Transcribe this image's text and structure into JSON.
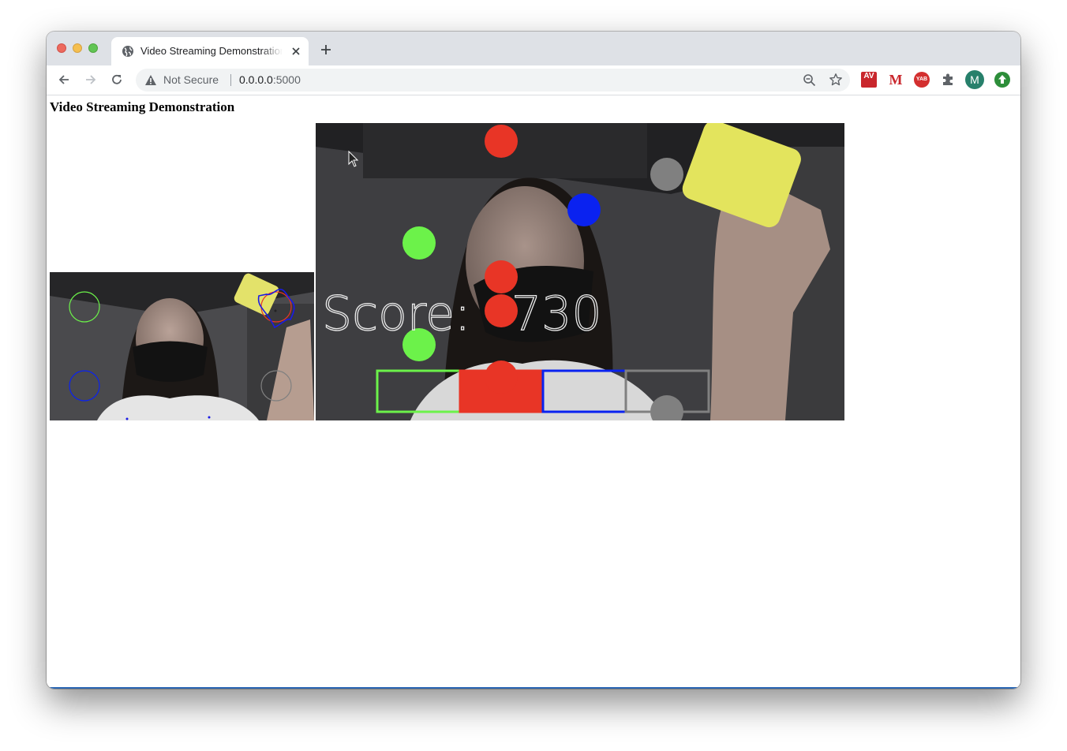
{
  "browser": {
    "tab_title": "Video Streaming Demonstration",
    "security_label": "Not Secure",
    "url_host": "0.0.0.0",
    "url_port": ":5000",
    "profile_initial": "M",
    "ext_av_label": "AV",
    "ext_m_label": "M",
    "ext_yab_label": "YAB"
  },
  "page": {
    "title": "Video Streaming Demonstration"
  },
  "game": {
    "score_label": "Score:",
    "score_value": "730",
    "target_colors": [
      "#6cf24a",
      "#e83526",
      "#0a22f0",
      "#808080"
    ],
    "falling_notes": [
      "red",
      "blue",
      "grey",
      "green",
      "red",
      "red",
      "green",
      "red",
      "grey"
    ]
  }
}
